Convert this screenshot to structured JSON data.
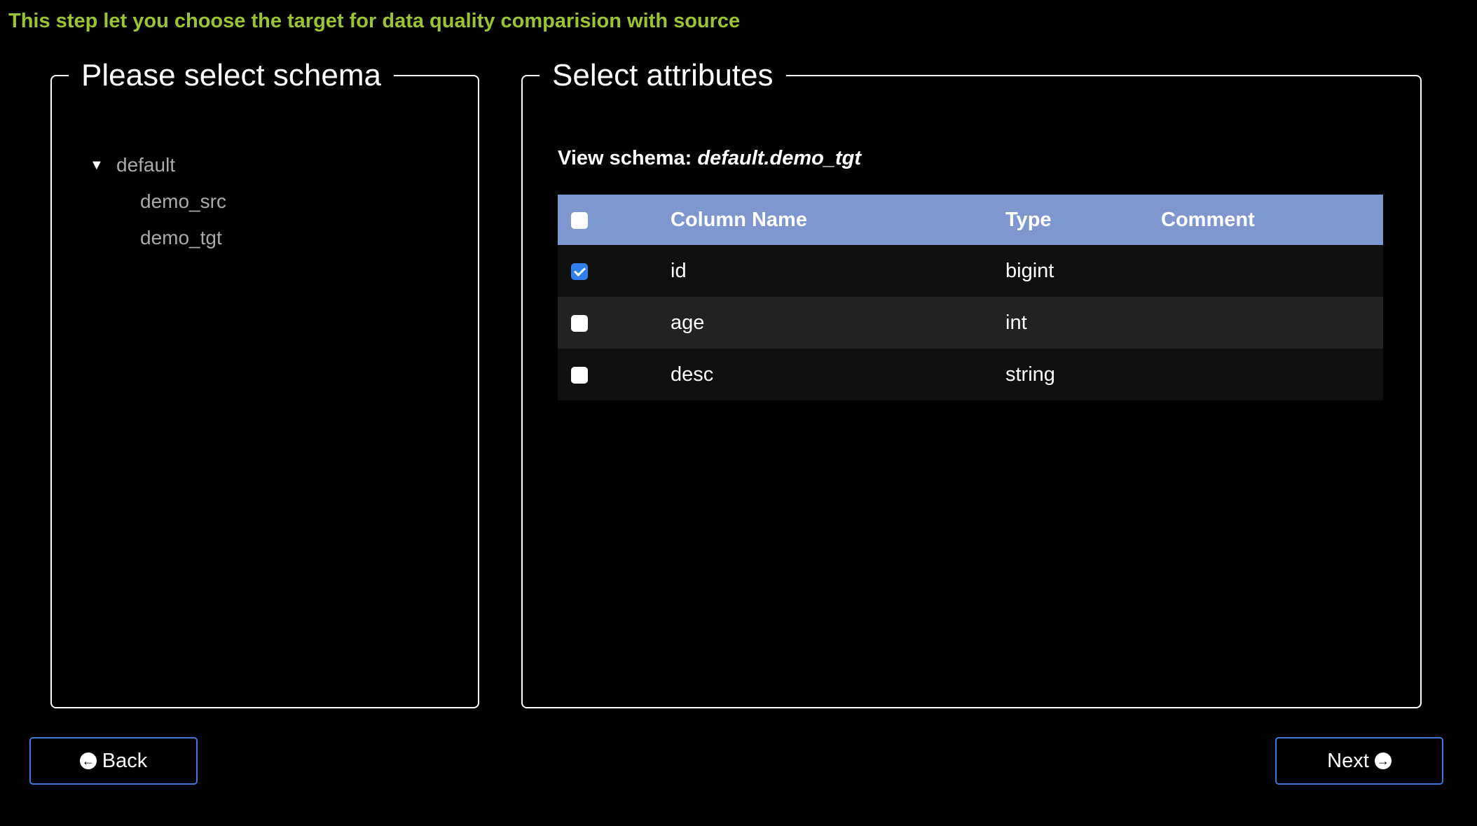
{
  "step_hint": "This step let you choose the target for data quality comparision with source",
  "schema_panel": {
    "legend": "Please select schema",
    "tree": {
      "root_label": "default",
      "children": [
        "demo_src",
        "demo_tgt"
      ]
    }
  },
  "attributes_panel": {
    "legend": "Select attributes",
    "view_schema_label": "View schema:",
    "view_schema_value": "default.demo_tgt",
    "table": {
      "headers": [
        "Column Name",
        "Type",
        "Comment"
      ],
      "header_checked": false,
      "rows": [
        {
          "checked": true,
          "name": "id",
          "type": "bigint",
          "comment": ""
        },
        {
          "checked": false,
          "name": "age",
          "type": "int",
          "comment": ""
        },
        {
          "checked": false,
          "name": "desc",
          "type": "string",
          "comment": ""
        }
      ]
    }
  },
  "buttons": {
    "back_label": "Back",
    "back_icon": "arrow-circle-left-icon",
    "next_label": "Next",
    "next_icon": "arrow-circle-right-icon"
  },
  "colors": {
    "hint": "#9ac431",
    "table_header": "#7f97cf",
    "button_border": "#3b7bd6",
    "checkbox_checked": "#2f80ed"
  }
}
